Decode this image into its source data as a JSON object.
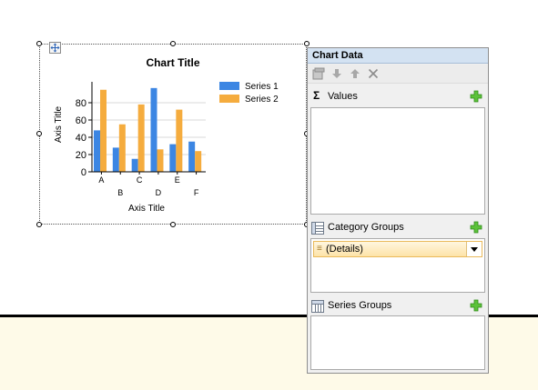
{
  "chart": {
    "title": "Chart Title",
    "x_axis_title": "Axis Title",
    "y_axis_title": "Axis Title"
  },
  "chart_data": {
    "type": "bar",
    "title": "Chart Title",
    "xlabel": "Axis Title",
    "ylabel": "Axis Title",
    "categories": [
      "A",
      "B",
      "C",
      "D",
      "E",
      "F"
    ],
    "series": [
      {
        "name": "Series 1",
        "color": "#3c86e3",
        "values": [
          48,
          28,
          15,
          97,
          32,
          35
        ]
      },
      {
        "name": "Series 2",
        "color": "#f5ac3e",
        "values": [
          95,
          55,
          78,
          26,
          72,
          24
        ]
      }
    ],
    "yticks": [
      0,
      20,
      40,
      60,
      80
    ],
    "ylim": [
      0,
      100
    ],
    "legend_position": "right",
    "grid": true
  },
  "panel": {
    "title": "Chart Data",
    "toolbar_icons": [
      "properties-icon",
      "move-down-icon",
      "move-up-icon",
      "delete-icon"
    ],
    "values": {
      "label": "Values",
      "icon": "sigma-icon"
    },
    "category_groups": {
      "label": "Category Groups",
      "icon": "category-groups-icon",
      "items": [
        "(Details)"
      ]
    },
    "series_groups": {
      "label": "Series Groups",
      "icon": "series-groups-icon"
    },
    "add_icon": "plus-icon",
    "sigma_glyph": "Σ"
  },
  "colors": {
    "panel_title_bg": "#d3e2f2",
    "group_row": "#fde3a8",
    "footer_band": "#fefae8",
    "add_plus": "#34a818"
  }
}
